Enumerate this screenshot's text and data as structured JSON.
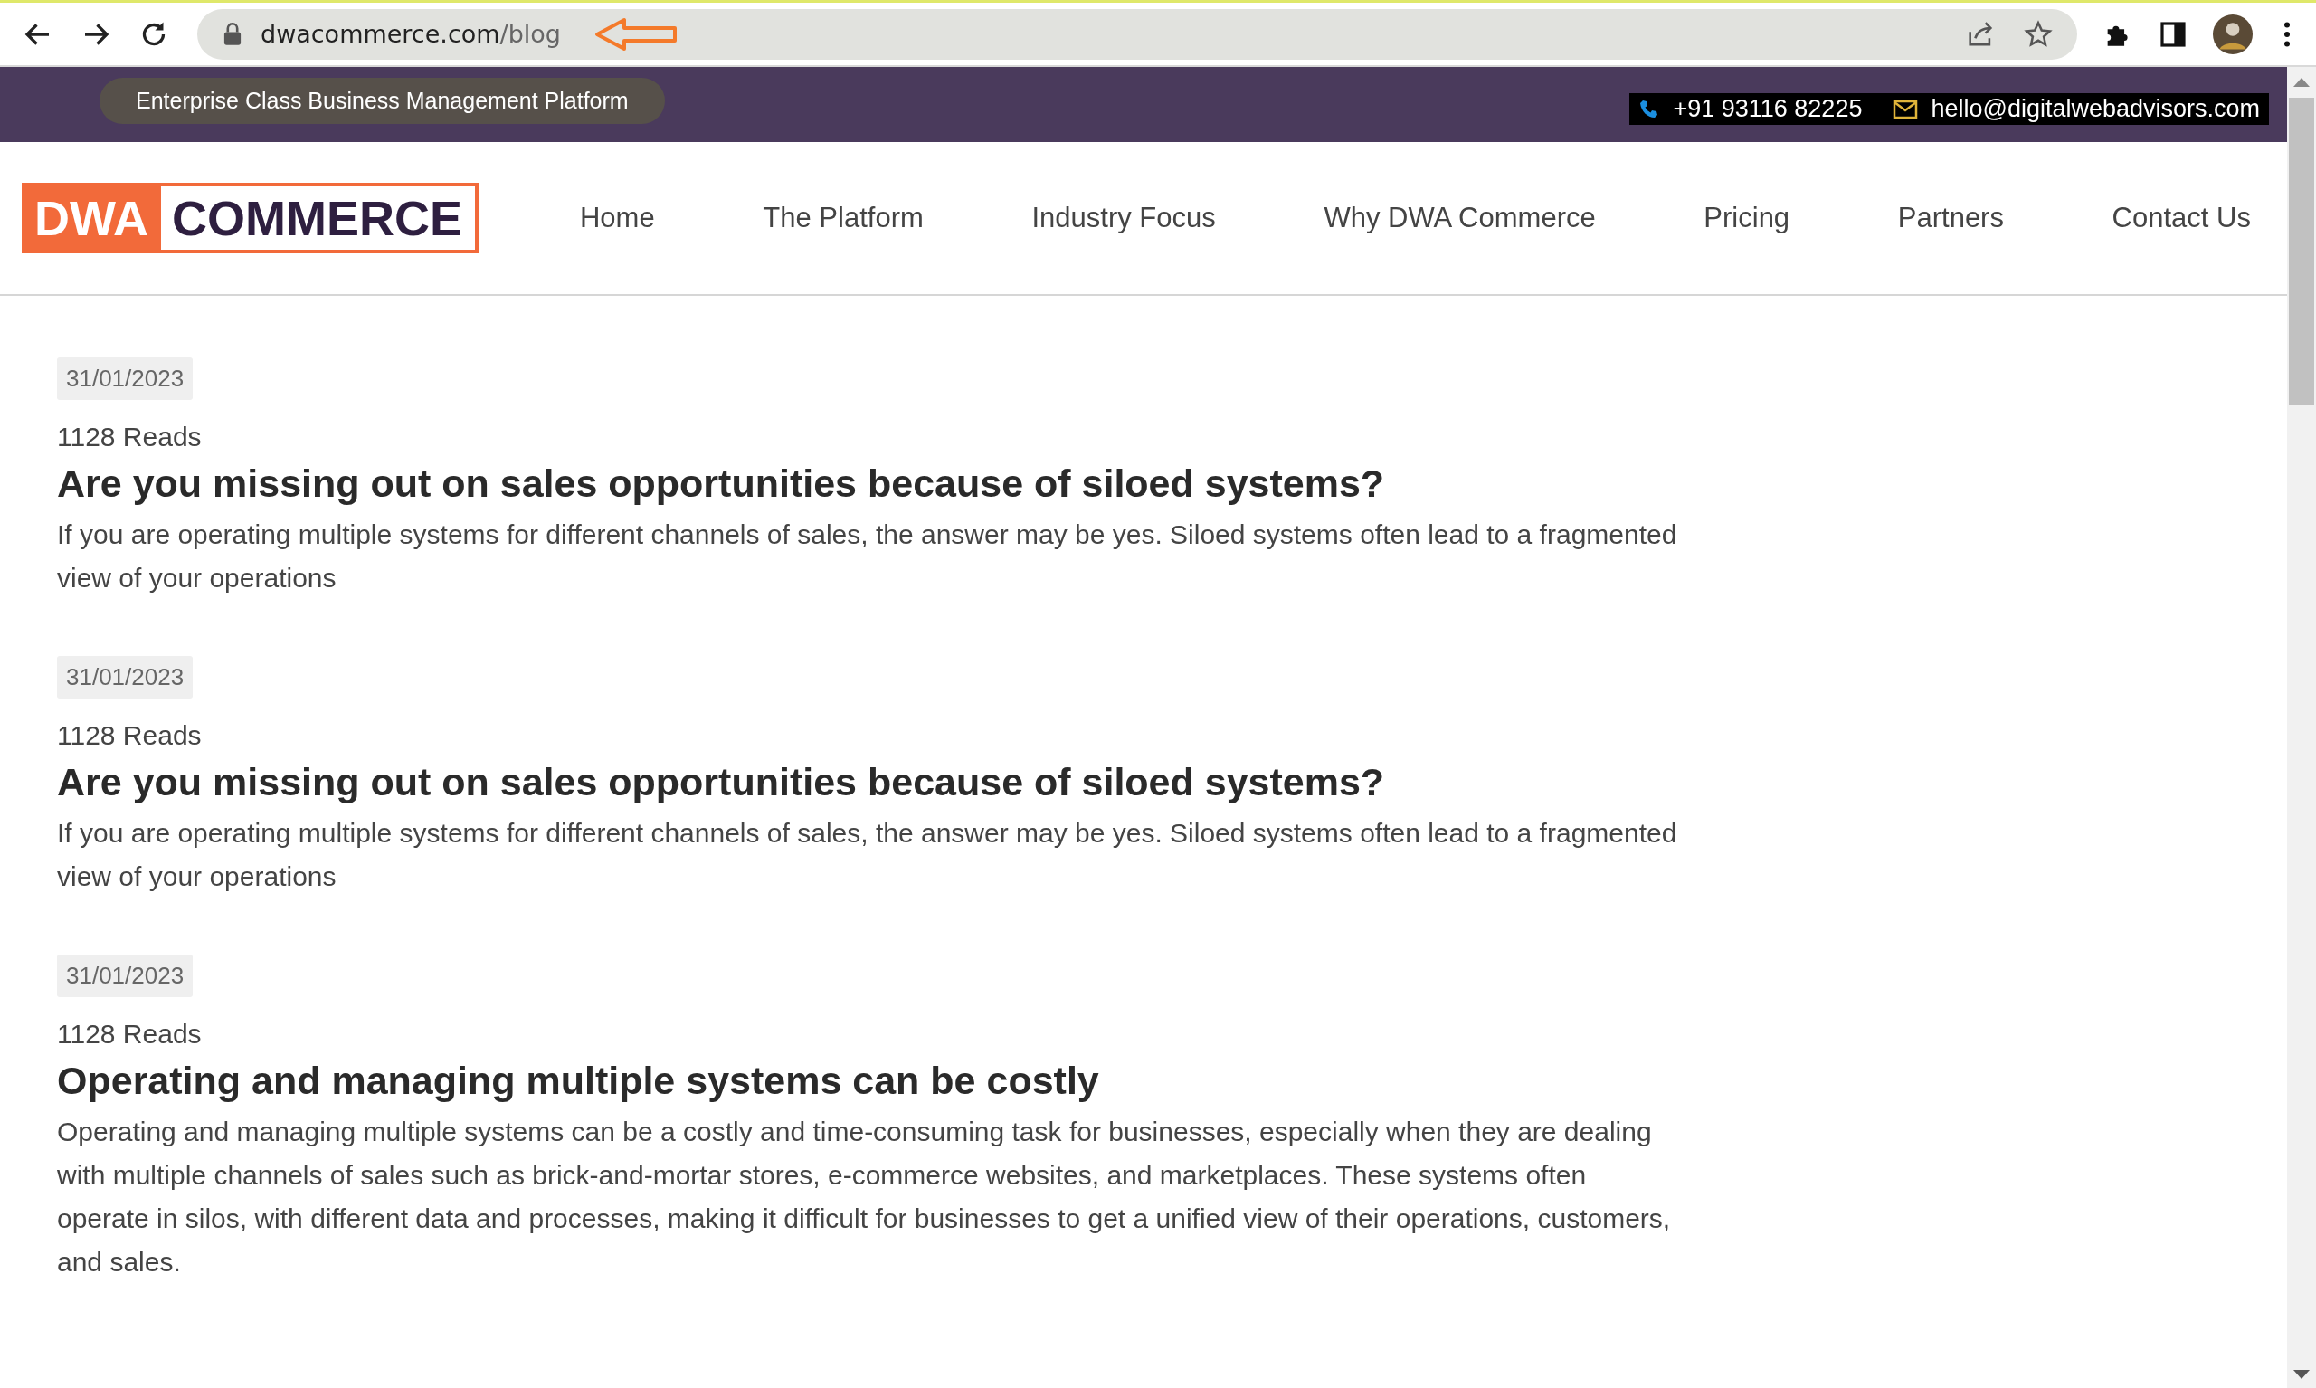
{
  "browser": {
    "url_host": "dwacommerce.com",
    "url_path": "/blog"
  },
  "top_bar": {
    "tagline": "Enterprise Class Business Management Platform",
    "phone": "+91 93116 82225",
    "email": "hello@digitalwebadvisors.com"
  },
  "logo": {
    "left": "DWA",
    "right": "COMMERCE"
  },
  "nav": [
    {
      "label": "Home"
    },
    {
      "label": "The Platform"
    },
    {
      "label": "Industry Focus"
    },
    {
      "label": "Why DWA Commerce"
    },
    {
      "label": "Pricing"
    },
    {
      "label": "Partners"
    },
    {
      "label": "Contact Us"
    }
  ],
  "posts": [
    {
      "date": "31/01/2023",
      "reads": "1128 Reads",
      "title": "Are you missing out on sales opportunities because of siloed systems?",
      "excerpt": "If you are operating multiple systems for different channels of sales, the answer may be yes. Siloed systems often lead to a fragmented view of your operations"
    },
    {
      "date": "31/01/2023",
      "reads": "1128 Reads",
      "title": "Are you missing out on sales opportunities because of siloed systems?",
      "excerpt": "If you are operating multiple systems for different channels of sales, the answer may be yes. Siloed systems often lead to a fragmented view of your operations"
    },
    {
      "date": "31/01/2023",
      "reads": "1128 Reads",
      "title": "Operating and managing multiple systems can be costly",
      "excerpt": "Operating and managing multiple systems can be a costly and time-consuming task for businesses, especially when they are dealing with multiple channels of sales such as brick-and-mortar stores, e-commerce websites, and marketplaces. These systems often operate in silos, with different data and processes, making it difficult for businesses to get a unified view of their operations, customers, and sales."
    }
  ]
}
